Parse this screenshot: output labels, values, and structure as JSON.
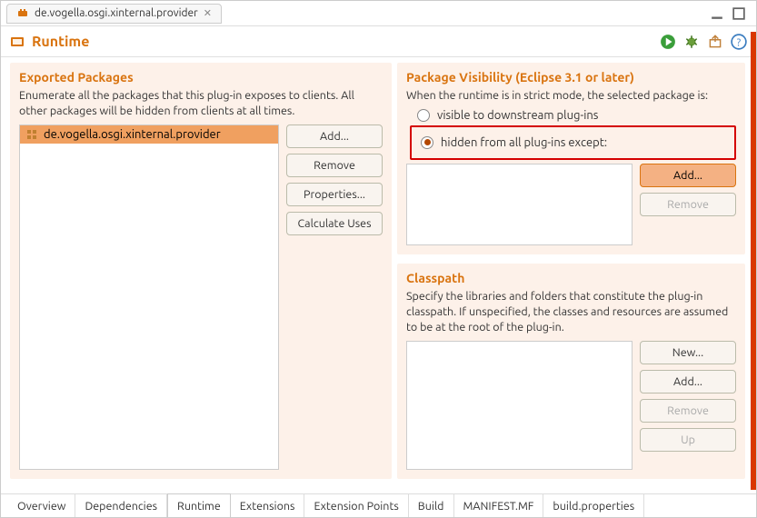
{
  "tab": {
    "title": "de.vogella.osgi.xinternal.provider"
  },
  "page": {
    "title": "Runtime"
  },
  "exported": {
    "title": "Exported Packages",
    "desc": "Enumerate all the packages that this plug-in exposes to clients.  All other packages will be hidden from clients at all times.",
    "items": [
      "de.vogella.osgi.xinternal.provider"
    ],
    "buttons": {
      "add": "Add...",
      "remove": "Remove",
      "properties": "Properties...",
      "calc": "Calculate Uses"
    }
  },
  "visibility": {
    "title": "Package Visibility (Eclipse 3.1 or later)",
    "desc": "When the runtime is in strict mode, the selected package is:",
    "opt_visible": "visible to downstream plug-ins",
    "opt_hidden": "hidden from all plug-ins except:",
    "selected": "hidden",
    "buttons": {
      "add": "Add...",
      "remove": "Remove"
    }
  },
  "classpath": {
    "title": "Classpath",
    "desc": "Specify the libraries and folders that constitute the plug-in classpath.  If unspecified, the classes and resources are assumed to be at the root of the plug-in.",
    "buttons": {
      "new": "New...",
      "add": "Add...",
      "remove": "Remove",
      "up": "Up"
    }
  },
  "bottom_tabs": [
    "Overview",
    "Dependencies",
    "Runtime",
    "Extensions",
    "Extension Points",
    "Build",
    "MANIFEST.MF",
    "build.properties"
  ],
  "active_bottom_tab": "Runtime"
}
